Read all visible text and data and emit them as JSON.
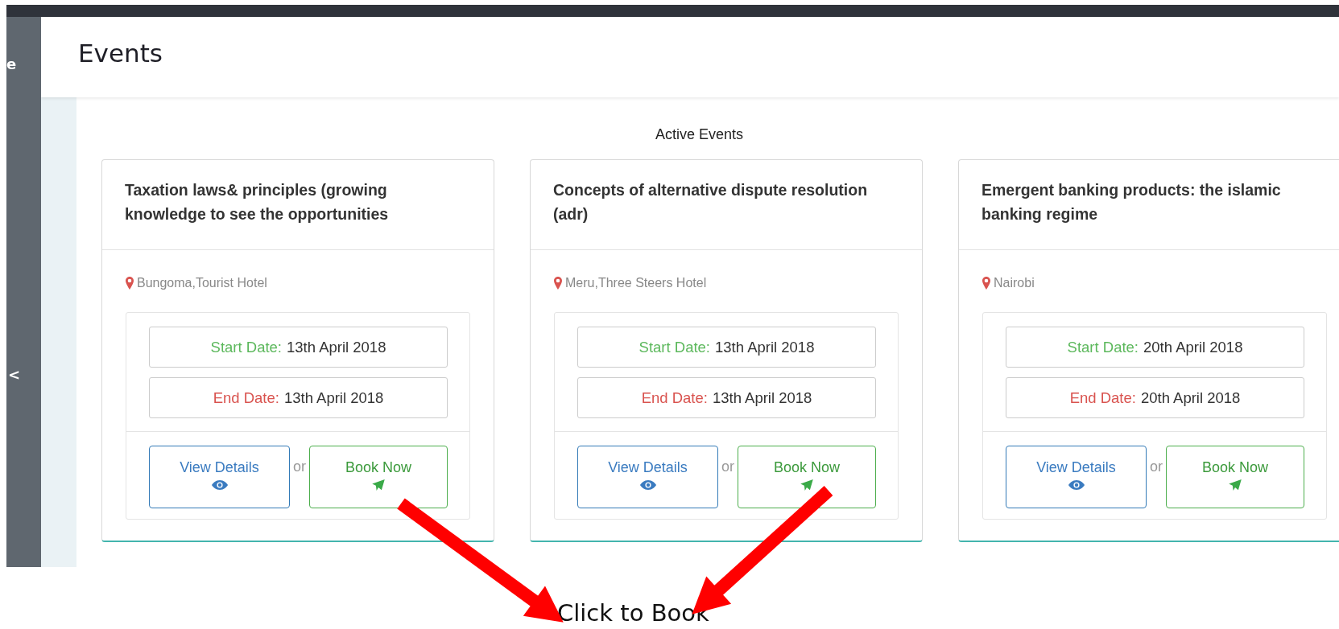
{
  "sidebar": {
    "partial_label": "e",
    "collapse_toggle": "<"
  },
  "page": {
    "title": "Events"
  },
  "section": {
    "title": "Active Events"
  },
  "events": [
    {
      "title": "Taxation laws& principles (growing knowledge to see the opportunities",
      "location": "Bungoma,Tourist Hotel",
      "start_label": "Start Date:",
      "start_date": "13th April 2018",
      "end_label": "End Date:",
      "end_date": "13th April 2018",
      "view_button": "View Details",
      "separator": "or",
      "book_button": "Book Now"
    },
    {
      "title": "Concepts of alternative dispute resolution (adr)",
      "location": "Meru,Three Steers Hotel",
      "start_label": "Start Date:",
      "start_date": "13th April 2018",
      "end_label": "End Date:",
      "end_date": "13th April 2018",
      "view_button": "View Details",
      "separator": "or",
      "book_button": "Book Now"
    },
    {
      "title": "Emergent banking products: the islamic banking regime",
      "location": "Nairobi",
      "start_label": "Start Date:",
      "start_date": "20th April 2018",
      "end_label": "End Date:",
      "end_date": "20th April 2018",
      "view_button": "View Details",
      "separator": "or",
      "book_button": "Book Now"
    }
  ],
  "annotation": {
    "text": "Click to Book"
  }
}
